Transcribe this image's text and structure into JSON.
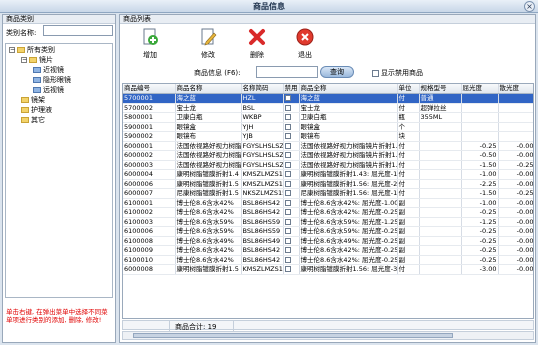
{
  "window": {
    "title": "商品信息"
  },
  "left": {
    "header": "商品类别",
    "category_label": "类别名称:",
    "category_value": "",
    "tree": [
      {
        "label": "所有类别",
        "level": 0,
        "expanded": true
      },
      {
        "label": "镜片",
        "level": 1,
        "expanded": true
      },
      {
        "label": "近视镜",
        "level": 2
      },
      {
        "label": "隐形眼镜",
        "level": 2
      },
      {
        "label": "远视镜",
        "level": 2
      },
      {
        "label": "镜架",
        "level": 1
      },
      {
        "label": "护理液",
        "level": 1
      },
      {
        "label": "其它",
        "level": 1
      }
    ],
    "hint": "单击右键, 在弹出菜单中选择不同菜单项进行类别的添加, 删除, 修改!"
  },
  "right": {
    "header": "商品列表",
    "toolbar": {
      "add": "增加",
      "edit": "修改",
      "delete": "删除",
      "exit": "退出"
    },
    "search": {
      "label": "商品信息 (F6):",
      "value": "",
      "button": "查询",
      "show_disabled": "显示禁用商品"
    },
    "columns": [
      "商品编号",
      "商品名称",
      "名称简码",
      "禁用",
      "商品全称",
      "单位",
      "规格型号",
      "屈光度",
      "散光度"
    ],
    "rows": [
      [
        "5700001",
        "海之蓝",
        "HZL",
        "",
        "海之蓝",
        "付",
        "普通",
        "",
        ""
      ],
      [
        "5700002",
        "宝士龙",
        "BSL",
        "",
        "宝士龙",
        "付",
        "超弹拉丝",
        "",
        ""
      ],
      [
        "5800001",
        "卫康白瓶",
        "WKBP",
        "",
        "卫康白瓶",
        "瓶",
        "355ML",
        "",
        ""
      ],
      [
        "5900001",
        "眼镜盒",
        "YJH",
        "",
        "眼镜盒",
        "个",
        "",
        "",
        ""
      ],
      [
        "5900002",
        "眼镜布",
        "YJB",
        "",
        "眼镜布",
        "块",
        "",
        "",
        ""
      ],
      [
        "6000001",
        "法国依视路好视力树脂",
        "FGYSLHSLSZ",
        "",
        "法国依视路好视力树脂镜片折射1.43",
        "付",
        "",
        "-0.25",
        "-0.00"
      ],
      [
        "6000002",
        "法国依视路好视力树脂",
        "FGYSLHSLSZ",
        "",
        "法国依视路好视力树脂镜片折射1.56",
        "付",
        "",
        "-0.50",
        "-0.00"
      ],
      [
        "6000003",
        "法国依视路好视力树脂",
        "FGYSLHSLSZ",
        "",
        "法国依视路好视力树脂镜片折射1.61",
        "付",
        "",
        "-1.50",
        "-0.25"
      ],
      [
        "6000004",
        "康明树脂镀膜折射1.4",
        "KMSZLMZS14",
        "",
        "康明树脂镀膜折射1.43: 屈光度-1.00",
        "付",
        "",
        "-1.00",
        "-0.00"
      ],
      [
        "6000006",
        "康明树脂镀膜折射1.5",
        "KMSZLMZS15",
        "",
        "康明树脂镀膜折射1.56: 屈光度-2.25",
        "付",
        "",
        "-2.25",
        "-0.00"
      ],
      [
        "6000007",
        "尼康树脂镀膜折射1.5",
        "NKSZLMZS15",
        "",
        "尼康树脂镀膜折射1.56: 屈光度-1.50",
        "付",
        "",
        "-1.50",
        "-0.25"
      ],
      [
        "6100001",
        "博士伦8.6含水42%",
        "BSL86HS42",
        "",
        "博士伦8.6含水42%: 屈光度-1.00",
        "副",
        "",
        "-1.00",
        "-0.00"
      ],
      [
        "6100002",
        "博士伦8.6含水42%",
        "BSL86HS42",
        "",
        "博士伦8.6含水42%: 屈光度-0.25",
        "副",
        "",
        "-0.25",
        "-0.00"
      ],
      [
        "6100003",
        "博士伦8.6含水59%",
        "BSL86HS59",
        "",
        "博士伦8.6含水59%: 屈光度-1.25",
        "副",
        "",
        "-1.25",
        "-0.00"
      ],
      [
        "6100006",
        "博士伦8.6含水59%",
        "BSL86HS59",
        "",
        "博士伦8.6含水59%: 屈光度-0.25",
        "副",
        "",
        "-0.25",
        "-0.00"
      ],
      [
        "6100008",
        "博士伦8.6含水49%",
        "BSL86HS49",
        "",
        "博士伦8.6含水49%: 屈光度-0.25",
        "副",
        "",
        "-0.25",
        "-0.00"
      ],
      [
        "6100009",
        "博士伦8.6含水42%",
        "BSL86HS42",
        "",
        "博士伦8.6含水42%: 屈光度-0.25",
        "副",
        "",
        "-0.25",
        "-0.00"
      ],
      [
        "6100010",
        "博士伦8.6含水42%",
        "BSL86HS42",
        "",
        "博士伦8.6含水42%: 屈光度-0.25",
        "副",
        "",
        "-0.25",
        "-0.00"
      ],
      [
        "6000008",
        "康明树脂镀膜折射1.5",
        "KMSZLMZS15",
        "",
        "康明树脂镀膜折射1.56: 屈光度-3.00",
        "付",
        "",
        "-3.00",
        "-0.00"
      ]
    ],
    "footer": {
      "total_label": "商品合计:",
      "total_value": "19"
    }
  }
}
